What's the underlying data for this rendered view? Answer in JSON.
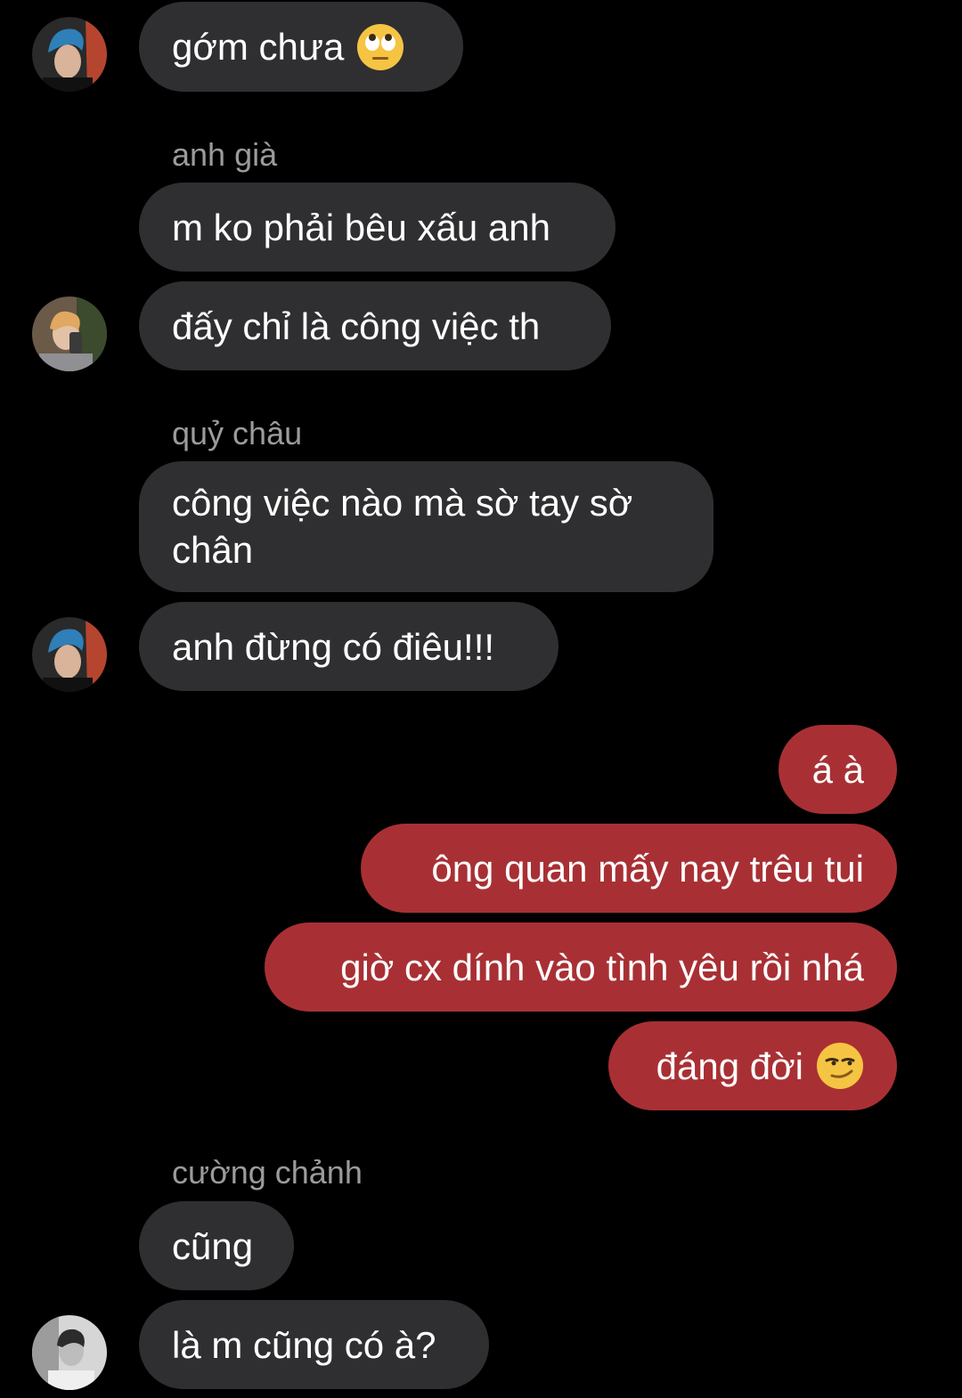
{
  "colors": {
    "background": "#000000",
    "incoming_bubble": "#2f2f31",
    "outgoing_bubble": "#a83034",
    "sender_name": "#9b9b9b",
    "text": "#ffffff"
  },
  "messages": [
    {
      "type": "incoming",
      "text": "gớm chưa",
      "emoji": "face-with-rolling-eyes-icon"
    },
    {
      "type": "sender",
      "text": "anh già"
    },
    {
      "type": "incoming",
      "text": "m ko phải bêu xấu anh"
    },
    {
      "type": "incoming",
      "text": "đấy chỉ là công việc th"
    },
    {
      "type": "sender",
      "text": "quỷ châu"
    },
    {
      "type": "incoming",
      "text": "công việc nào mà sờ tay sờ chân"
    },
    {
      "type": "incoming",
      "text": "anh đừng có điêu!!!"
    },
    {
      "type": "outgoing",
      "text": "á à"
    },
    {
      "type": "outgoing",
      "text": "ông quan mấy nay trêu tui"
    },
    {
      "type": "outgoing",
      "text": "giờ cx dính vào tình yêu rồi nhá"
    },
    {
      "type": "outgoing",
      "text": "đáng đời",
      "emoji": "smirking-face-icon"
    },
    {
      "type": "sender",
      "text": "cường chảnh"
    },
    {
      "type": "incoming",
      "text": "cũng"
    },
    {
      "type": "incoming",
      "text": "là m cũng có à?"
    }
  ]
}
